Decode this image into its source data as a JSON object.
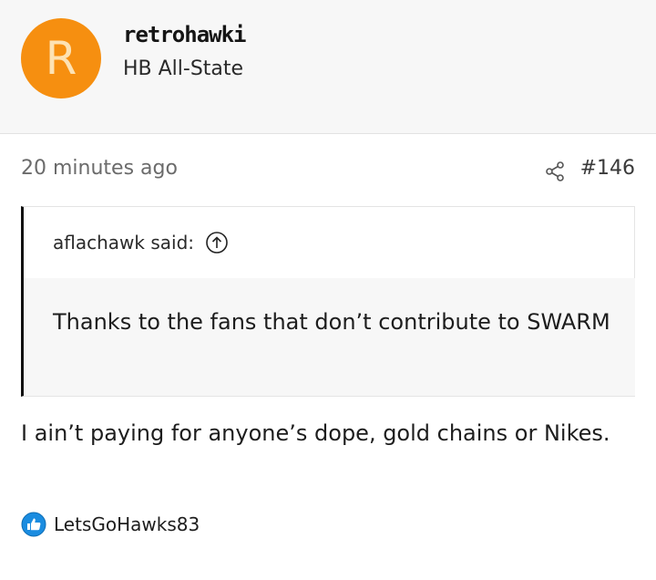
{
  "author": {
    "avatar_letter": "R",
    "avatar_color": "#f68f10",
    "username": "retrohawki",
    "title": "HB All-State"
  },
  "post": {
    "timestamp": "20 minutes ago",
    "number": "#146",
    "share_icon": "share-icon",
    "quote": {
      "attribution": "aflachawk said:",
      "text": "Thanks to the fans that don’t contribute to SWARM"
    },
    "body": "I ain’t paying for anyone’s dope, gold chains or Nikes.",
    "reactions": {
      "icon": "like-icon",
      "users": "LetsGoHawks83"
    }
  }
}
